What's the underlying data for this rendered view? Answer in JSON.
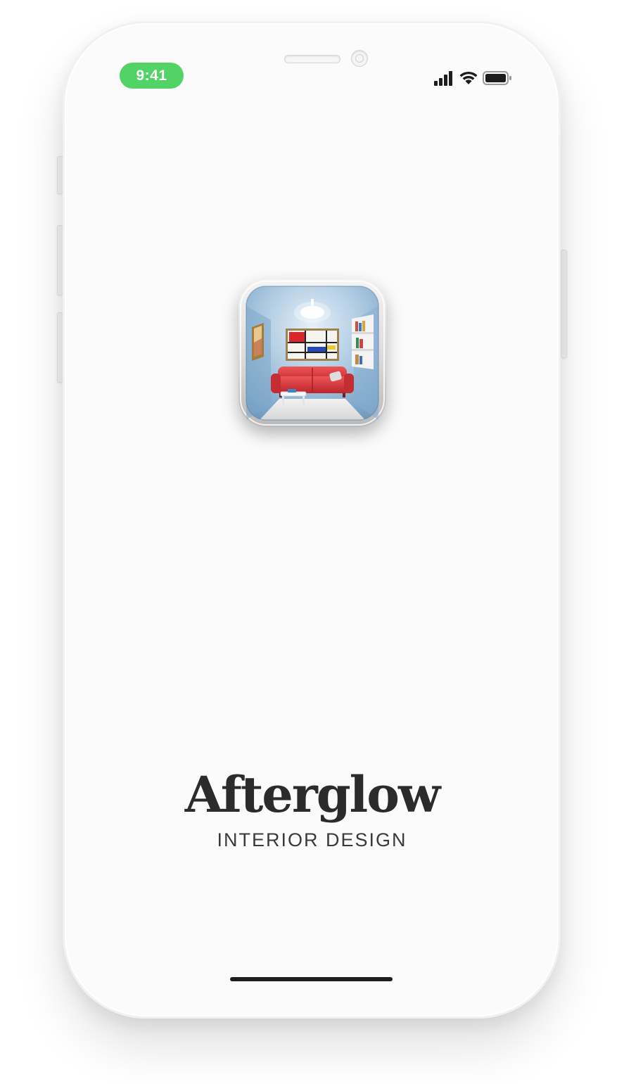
{
  "status_bar": {
    "time": "9:41",
    "time_pill_color": "#52d365",
    "icons": [
      "cellular-signal-icon",
      "wifi-icon",
      "battery-icon"
    ]
  },
  "splash": {
    "app_icon": "interior-room-app-icon",
    "title": "Afterglow",
    "subtitle": "INTERIOR DESIGN"
  },
  "colors": {
    "background": "#fbfbfb",
    "title_text": "#2b2b2b",
    "sofa_red": "#d83a3e",
    "room_blue": "#9cc1dc"
  }
}
